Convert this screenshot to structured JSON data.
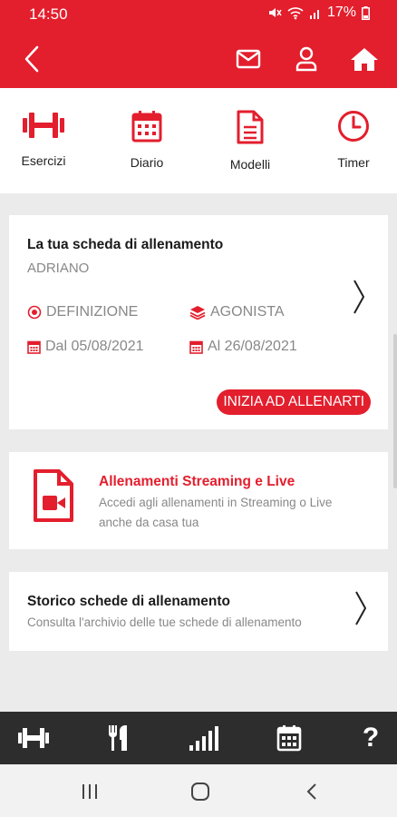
{
  "status": {
    "time": "14:50",
    "battery": "17%"
  },
  "colors": {
    "brand": "#e31e2d",
    "text_grey": "#888888",
    "dark_bar": "#2d2d2d"
  },
  "appbar": {
    "icons": [
      "back-icon",
      "mail-icon",
      "user-icon",
      "home-icon"
    ]
  },
  "topnav": [
    {
      "label": "Esercizi",
      "icon": "dumbbell-icon"
    },
    {
      "label": "Diario",
      "icon": "calendar-icon"
    },
    {
      "label": "Modelli",
      "icon": "document-icon"
    },
    {
      "label": "Timer",
      "icon": "clock-icon"
    }
  ],
  "plan_card": {
    "title": "La tua scheda di allenamento",
    "name": "ADRIANO",
    "goal": "DEFINIZIONE",
    "level": "AGONISTA",
    "date_from": "Dal 05/08/2021",
    "date_to": "Al 26/08/2021",
    "cta": "INIZIA AD ALLENARTI"
  },
  "streaming_card": {
    "title": "Allenamenti Streaming e Live",
    "desc_line1": "Accedi agli allenamenti in Streaming o Live",
    "desc_line2": "anche da casa tua"
  },
  "history_card": {
    "title": "Storico schede di allenamento",
    "desc": "Consulta l'archivio delle tue schede di allenamento"
  },
  "bottomnav": [
    "dumbbell-icon",
    "fork-knife-icon",
    "signal-bars-icon",
    "calendar-icon",
    "help-icon"
  ],
  "help_glyph": "?"
}
